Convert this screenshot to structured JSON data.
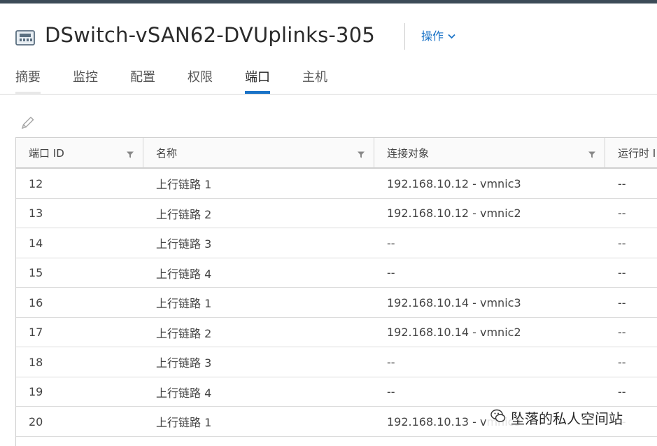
{
  "header": {
    "title": "DSwitch-vSAN62-DVUplinks-305",
    "actions_label": "操作",
    "icon": "distributed-switch-icon"
  },
  "tabs": [
    {
      "label": "摘要",
      "active": false
    },
    {
      "label": "监控",
      "active": false
    },
    {
      "label": "配置",
      "active": false
    },
    {
      "label": "权限",
      "active": false
    },
    {
      "label": "端口",
      "active": true
    },
    {
      "label": "主机",
      "active": false
    }
  ],
  "toolbar": {
    "edit_icon": "pencil-icon"
  },
  "table": {
    "columns": [
      "端口 ID",
      "名称",
      "连接对象",
      "运行时 I"
    ],
    "rows": [
      {
        "id": "12",
        "name": "上行链路 1",
        "connectee": "192.168.10.12 - vmnic3",
        "runtime": "--"
      },
      {
        "id": "13",
        "name": "上行链路 2",
        "connectee": "192.168.10.12 - vmnic2",
        "runtime": "--"
      },
      {
        "id": "14",
        "name": "上行链路 3",
        "connectee": "--",
        "runtime": "--"
      },
      {
        "id": "15",
        "name": "上行链路 4",
        "connectee": "--",
        "runtime": "--"
      },
      {
        "id": "16",
        "name": "上行链路 1",
        "connectee": "192.168.10.14 - vmnic3",
        "runtime": "--"
      },
      {
        "id": "17",
        "name": "上行链路 2",
        "connectee": "192.168.10.14 - vmnic2",
        "runtime": "--"
      },
      {
        "id": "18",
        "name": "上行链路 3",
        "connectee": "--",
        "runtime": "--"
      },
      {
        "id": "19",
        "name": "上行链路 4",
        "connectee": "--",
        "runtime": "--"
      },
      {
        "id": "20",
        "name": "上行链路 1",
        "connectee": "192.168.10.13 - vmnic3",
        "runtime": "--"
      }
    ]
  },
  "watermark": {
    "text": "坠落的私人空间站"
  },
  "colors": {
    "accent": "#1a73c7",
    "topbar": "#3c4b57"
  }
}
